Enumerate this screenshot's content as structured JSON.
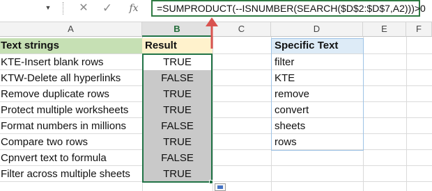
{
  "formula_bar": {
    "cancel_icon": "✕",
    "enter_icon": "✓",
    "fx_label": "fx",
    "formula": "=SUMPRODUCT(--ISNUMBER(SEARCH($D$2:$D$7,A2)))>0"
  },
  "columns": [
    "A",
    "B",
    "C",
    "D",
    "E",
    "F"
  ],
  "headers": {
    "a": "Text strings",
    "b": "Result",
    "d": "Specific Text"
  },
  "rows": [
    {
      "text": "KTE-Insert blank rows",
      "result": "TRUE"
    },
    {
      "text": "KTW-Delete all hyperlinks",
      "result": "FALSE"
    },
    {
      "text": "Remove duplicate rows",
      "result": "TRUE"
    },
    {
      "text": "Protect multiple worksheets",
      "result": "TRUE"
    },
    {
      "text": "Format numbers in millions",
      "result": "FALSE"
    },
    {
      "text": "Compare two rows",
      "result": "TRUE"
    },
    {
      "text": "Cpnvert text to formula",
      "result": "FALSE"
    },
    {
      "text": "Filter across multiple sheets",
      "result": "TRUE"
    }
  ],
  "specific_text": [
    "filter",
    "KTE",
    "remove",
    "convert",
    "sheets",
    "rows"
  ],
  "colors": {
    "header_a": "#c6e0b4",
    "header_b": "#fff2cc",
    "header_d": "#ddebf7",
    "selection": "#217346",
    "arrow": "#d9534f"
  }
}
